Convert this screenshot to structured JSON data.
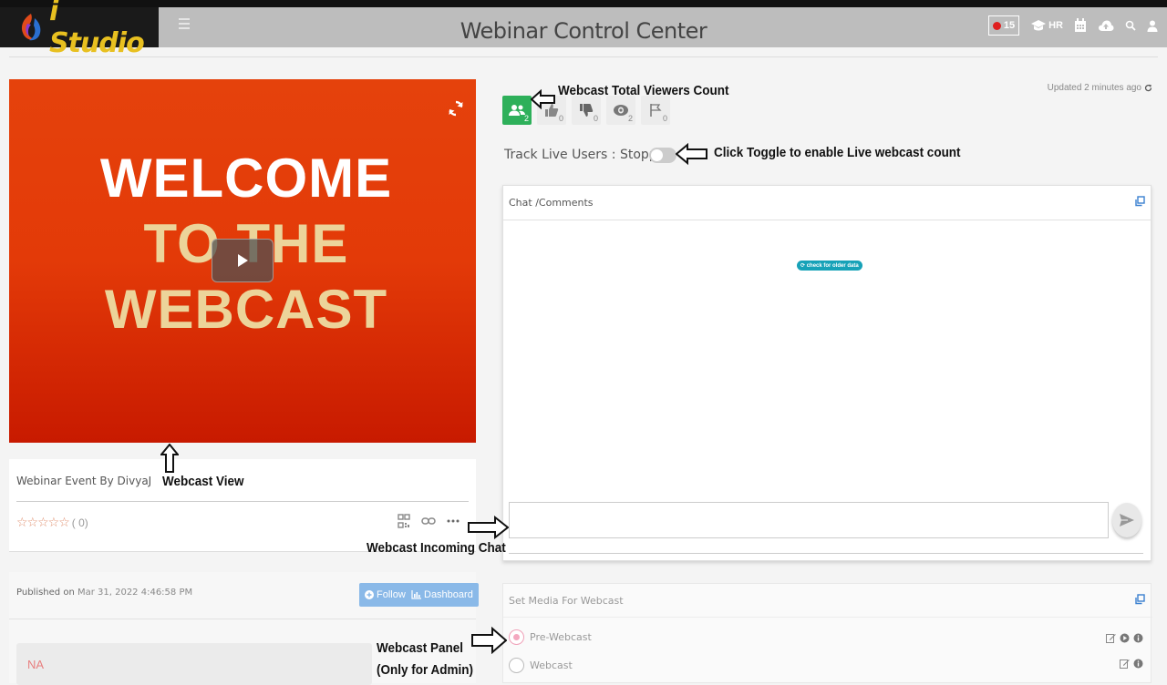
{
  "header": {
    "logo_text": "i Studio",
    "title": "Webinar Control Center",
    "rec_count": "15",
    "user_short": "HR"
  },
  "video": {
    "line1": "WELCOME",
    "line2": "TO THE",
    "line3": "WEBCAST"
  },
  "event": {
    "title": "Webinar Event By DivyaJ",
    "stars": "☆☆☆☆☆",
    "rating_count": "( 0)",
    "published_label": "Published on",
    "published_date": "Mar 31, 2022 4:46:58 PM",
    "follow_label": "Follow",
    "dashboard_label": "Dashboard",
    "na_text": "NA"
  },
  "stats": {
    "viewers": "2",
    "likes": "0",
    "dislikes": "0",
    "views": "2",
    "flags": "0",
    "updated": "Updated 2 minutes ago"
  },
  "track": {
    "label": "Track Live Users : Stopped"
  },
  "chat": {
    "title": "Chat /Comments",
    "older_label": "check for older data",
    "input_value": ""
  },
  "media": {
    "title": "Set Media For Webcast",
    "options": [
      "Pre-Webcast",
      "Webcast"
    ]
  },
  "annotations": {
    "viewers_count": "Webcast Total Viewers Count",
    "toggle_hint": "Click Toggle to enable Live webcast count",
    "webcast_view": "Webcast View",
    "incoming_chat": "Webcast Incoming Chat",
    "panel_line1": "Webcast Panel",
    "panel_line2": "(Only for Admin)"
  },
  "colors": {
    "header_bg": "#bdbdbd",
    "logo_bg": "#1a1a1a",
    "logo_text": "#e8c020",
    "video_red": "#e33a08",
    "viewer_green": "#2eb05a",
    "button_blue": "#8ab9e8",
    "older_teal": "#17a2b8"
  }
}
